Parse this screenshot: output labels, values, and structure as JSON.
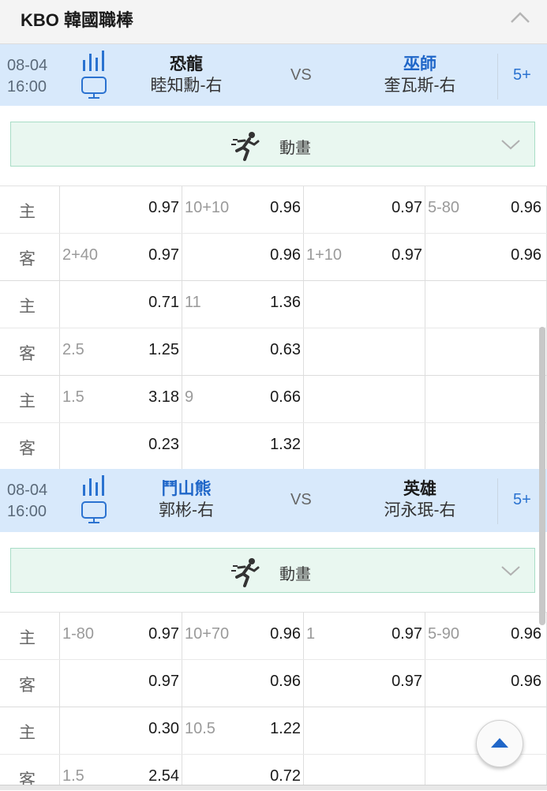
{
  "league": {
    "title": "KBO 韓國職棒",
    "collapse_icon": "chevron-up-icon"
  },
  "colors": {
    "match_header_bg": "#d8e9fb",
    "favorite_team": "#1f66c8",
    "animation_bar_bg": "#e9f7f0",
    "accent": "#2a72d0"
  },
  "matches": [
    {
      "date": "08-04",
      "time": "16:00",
      "home": {
        "team": "恐龍",
        "pitcher": "睦知勳-右",
        "favorite": false
      },
      "away": {
        "team": "巫師",
        "pitcher": "奎瓦斯-右",
        "favorite": true
      },
      "vs": "VS",
      "more": "5+",
      "animation_label": "動畫",
      "odds": [
        {
          "side": "主",
          "c1_line": "",
          "c1_odd": "0.97",
          "c2_line": "10+10",
          "c2_odd": "0.96",
          "c3_line": "",
          "c3_odd": "0.97",
          "c4_line": "5-80",
          "c4_odd": "0.96"
        },
        {
          "side": "客",
          "c1_line": "2+40",
          "c1_odd": "0.97",
          "c2_line": "",
          "c2_odd": "0.96",
          "c3_line": "1+10",
          "c3_odd": "0.97",
          "c4_line": "",
          "c4_odd": "0.96"
        },
        {
          "side": "主",
          "c1_line": "",
          "c1_odd": "0.71",
          "c2_line": "11",
          "c2_odd": "1.36",
          "c3_line": "",
          "c3_odd": "",
          "c4_line": "",
          "c4_odd": ""
        },
        {
          "side": "客",
          "c1_line": "2.5",
          "c1_odd": "1.25",
          "c2_line": "",
          "c2_odd": "0.63",
          "c3_line": "",
          "c3_odd": "",
          "c4_line": "",
          "c4_odd": ""
        },
        {
          "side": "主",
          "c1_line": "1.5",
          "c1_odd": "3.18",
          "c2_line": "9",
          "c2_odd": "0.66",
          "c3_line": "",
          "c3_odd": "",
          "c4_line": "",
          "c4_odd": ""
        },
        {
          "side": "客",
          "c1_line": "",
          "c1_odd": "0.23",
          "c2_line": "",
          "c2_odd": "1.32",
          "c3_line": "",
          "c3_odd": "",
          "c4_line": "",
          "c4_odd": ""
        }
      ]
    },
    {
      "date": "08-04",
      "time": "16:00",
      "home": {
        "team": "鬥山熊",
        "pitcher": "郭彬-右",
        "favorite": true
      },
      "away": {
        "team": "英雄",
        "pitcher": "河永珉-右",
        "favorite": false
      },
      "vs": "VS",
      "more": "5+",
      "animation_label": "動畫",
      "odds": [
        {
          "side": "主",
          "c1_line": "1-80",
          "c1_odd": "0.97",
          "c2_line": "10+70",
          "c2_odd": "0.96",
          "c3_line": "1",
          "c3_odd": "0.97",
          "c4_line": "5-90",
          "c4_odd": "0.96"
        },
        {
          "side": "客",
          "c1_line": "",
          "c1_odd": "0.97",
          "c2_line": "",
          "c2_odd": "0.96",
          "c3_line": "",
          "c3_odd": "0.97",
          "c4_line": "",
          "c4_odd": "0.96"
        },
        {
          "side": "主",
          "c1_line": "",
          "c1_odd": "0.30",
          "c2_line": "10.5",
          "c2_odd": "1.22",
          "c3_line": "",
          "c3_odd": "",
          "c4_line": "",
          "c4_odd": ""
        },
        {
          "side": "客",
          "c1_line": "1.5",
          "c1_odd": "2.54",
          "c2_line": "",
          "c2_odd": "0.72",
          "c3_line": "",
          "c3_odd": "",
          "c4_line": "",
          "c4_odd": ""
        }
      ]
    }
  ],
  "back_to_top_icon": "arrow-up-icon"
}
